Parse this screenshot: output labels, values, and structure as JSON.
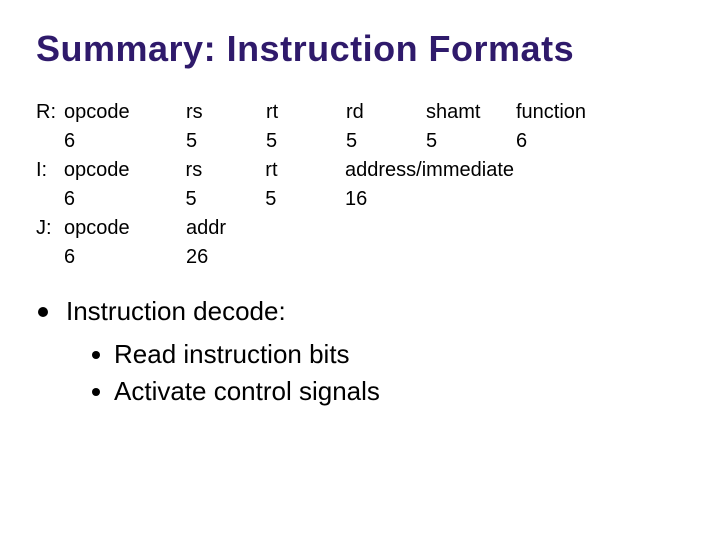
{
  "title": "Summary: Instruction Formats",
  "formats": {
    "R": {
      "label": "R:",
      "fields": [
        "opcode",
        "rs",
        "rt",
        "rd",
        "shamt",
        "function"
      ],
      "bits": [
        "6",
        "5",
        "5",
        "5",
        "5",
        "6"
      ]
    },
    "I": {
      "label": "I:",
      "fields": [
        "opcode",
        "rs",
        "rt",
        "address/immediate"
      ],
      "bits": [
        "6",
        "5",
        "5",
        "16"
      ]
    },
    "J": {
      "label": "J:",
      "fields": [
        "opcode",
        "addr"
      ],
      "bits": [
        "6",
        "26"
      ]
    }
  },
  "decode": {
    "heading": "Instruction decode:",
    "items": [
      "Read instruction bits",
      "Activate control signals"
    ]
  }
}
